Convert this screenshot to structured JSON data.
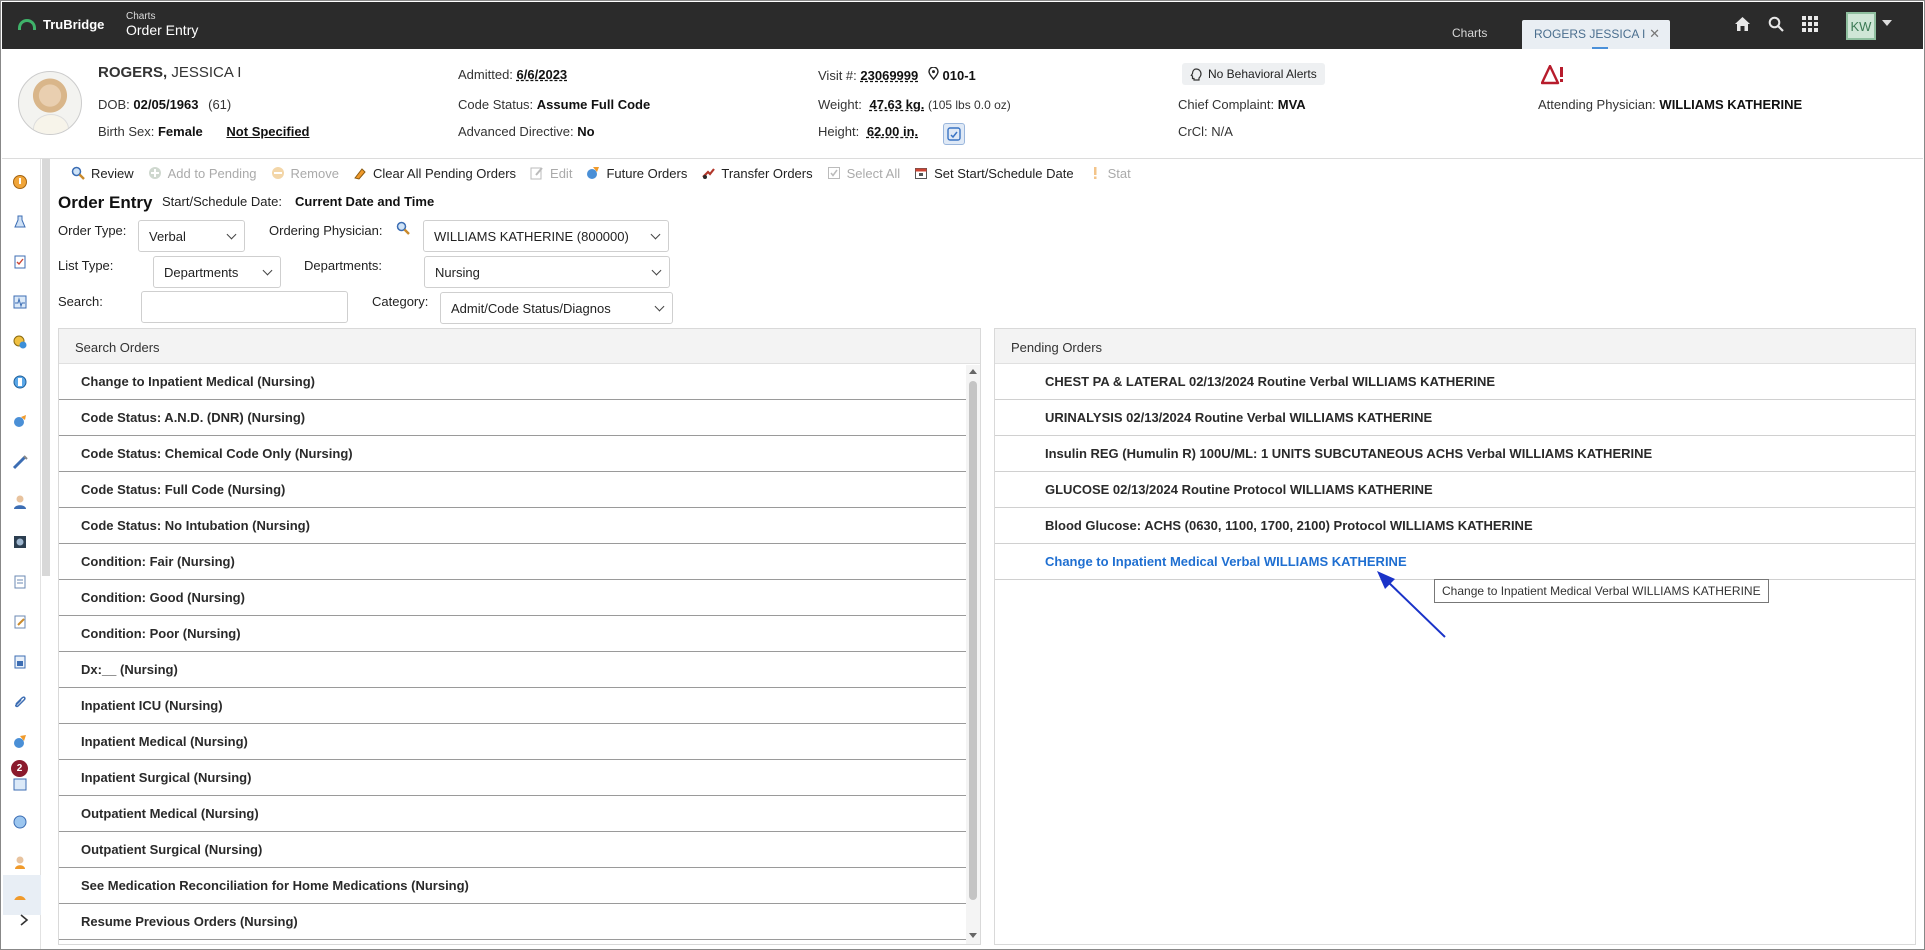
{
  "topbar": {
    "brand": "TruBridge",
    "crumb_small": "Charts",
    "crumb_title": "Order Entry",
    "tabs": [
      {
        "label": "Charts"
      },
      {
        "label": "ROGERS JESSICA I"
      }
    ],
    "icons": [
      "home-icon",
      "search-icon",
      "apps-grid-icon"
    ],
    "user_initials": "KW"
  },
  "patient": {
    "last_name": "ROGERS,",
    "first_name": "JESSICA I",
    "dob_label": "DOB:",
    "dob": "02/05/1963",
    "age": "(61)",
    "birth_sex_label": "Birth Sex:",
    "birth_sex": "Female",
    "gender_identity": "Not Specified",
    "admitted_label": "Admitted:",
    "admitted": "6/6/2023",
    "code_status_label": "Code Status:",
    "code_status": "Assume Full Code",
    "adv_directive_label": "Advanced Directive:",
    "adv_directive": "No",
    "visit_label": "Visit #:",
    "visit": "23069999",
    "room": "010-1",
    "weight_label": "Weight:",
    "weight": "47.63 kg.",
    "weight_lbs": "(105 lbs 0.0 oz)",
    "height_label": "Height:",
    "height": "62.00 in.",
    "behavioral_alerts": "No Behavioral Alerts",
    "chief_complaint_label": "Chief Complaint:",
    "chief_complaint": "MVA",
    "crcl_label": "CrCl:",
    "crcl": "N/A",
    "attending_label": "Attending Physician:",
    "attending": "WILLIAMS KATHERINE"
  },
  "nav": {
    "badge_count": "2"
  },
  "toolbar": {
    "buttons": [
      {
        "label": "Review",
        "enabled": true
      },
      {
        "label": "Add to Pending",
        "enabled": false
      },
      {
        "label": "Remove",
        "enabled": false
      },
      {
        "label": "Clear All Pending Orders",
        "enabled": true
      },
      {
        "label": "Edit",
        "enabled": false
      },
      {
        "label": "Future Orders",
        "enabled": true
      },
      {
        "label": "Transfer Orders",
        "enabled": true
      },
      {
        "label": "Select All",
        "enabled": false
      },
      {
        "label": "Set Start/Schedule Date",
        "enabled": true
      },
      {
        "label": "Stat",
        "enabled": false
      }
    ]
  },
  "form": {
    "title": "Order Entry",
    "start_label": "Start/Schedule Date:",
    "start_value": "Current Date and Time",
    "order_type_label": "Order Type:",
    "order_type": "Verbal",
    "ordering_physician_label": "Ordering Physician:",
    "ordering_physician": "WILLIAMS KATHERINE (800000)",
    "list_type_label": "List Type:",
    "list_type": "Departments",
    "departments_label": "Departments:",
    "departments": "Nursing",
    "search_label": "Search:",
    "search_value": "",
    "category_label": "Category:",
    "category": "Admit/Code Status/Diagnos"
  },
  "search_orders": {
    "title": "Search Orders",
    "items": [
      "Change to Inpatient Medical (Nursing)",
      "Code Status: A.N.D. (DNR) (Nursing)",
      "Code Status: Chemical Code Only (Nursing)",
      "Code Status: Full Code (Nursing)",
      "Code Status: No Intubation (Nursing)",
      "Condition: Fair (Nursing)",
      "Condition: Good (Nursing)",
      "Condition: Poor (Nursing)",
      "Dx:__ (Nursing)",
      "Inpatient ICU (Nursing)",
      "Inpatient Medical (Nursing)",
      "Inpatient Surgical (Nursing)",
      "Outpatient Medical (Nursing)",
      "Outpatient Surgical (Nursing)",
      "See Medication Reconciliation for Home Medications (Nursing)",
      "Resume Previous Orders (Nursing)"
    ]
  },
  "pending_orders": {
    "title": "Pending Orders",
    "items": [
      "CHEST PA & LATERAL 02/13/2024 Routine Verbal WILLIAMS KATHERINE",
      "URINALYSIS 02/13/2024 Routine Verbal WILLIAMS KATHERINE",
      "Insulin REG (Humulin R) 100U/ML: 1 UNITS SUBCUTANEOUS ACHS Verbal WILLIAMS KATHERINE",
      "GLUCOSE 02/13/2024 Routine Protocol WILLIAMS KATHERINE",
      "Blood Glucose: ACHS (0630, 1100, 1700, 2100) Protocol WILLIAMS KATHERINE",
      "Change to Inpatient Medical Verbal WILLIAMS KATHERINE"
    ],
    "tooltip": "Change to Inpatient Medical Verbal WILLIAMS KATHERINE"
  },
  "colors": {
    "topbar": "#2b2b2b",
    "link_blue": "#1f6fd1",
    "badge": "#8b1a2d",
    "arrow": "#1a33c8"
  }
}
